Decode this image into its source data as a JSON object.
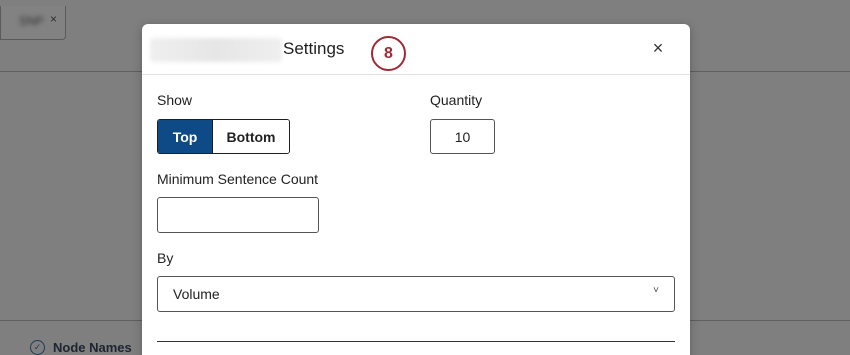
{
  "background": {
    "tab_close_glyph": "×",
    "tab_label": "SNP",
    "node_names_label": "Node Names"
  },
  "modal": {
    "title": "Settings",
    "step_badge": "8",
    "close_glyph": "×",
    "show_label": "Show",
    "show_options": [
      "Top",
      "Bottom"
    ],
    "show_selected": "Top",
    "quantity_label": "Quantity",
    "quantity_value": "10",
    "min_sentence_label": "Minimum Sentence Count",
    "min_sentence_value": "",
    "by_label": "By",
    "by_value": "Volume",
    "chevron_glyph": "˅"
  },
  "colors": {
    "accent": "#0e4a86",
    "badge": "#9f2a36",
    "overlay": "#7f7f7f"
  }
}
